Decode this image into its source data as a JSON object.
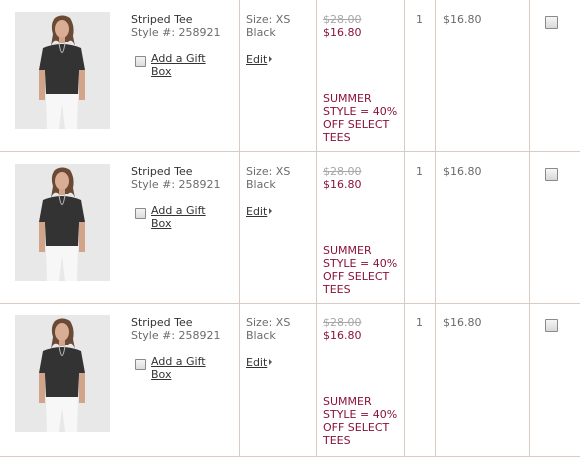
{
  "cart": {
    "items": [
      {
        "name": "Striped Tee",
        "style": "Style #: 258921",
        "gift_label": "Add a Gift Box",
        "size": "Size: XS",
        "color": "Black",
        "edit_label": "Edit",
        "original_price": "$28.00",
        "sale_price": "$16.80",
        "promo": "SUMMER STYLE = 40% OFF SELECT TEES",
        "quantity": "1",
        "total": "$16.80",
        "image_icon": "product-photo"
      },
      {
        "name": "Striped Tee",
        "style": "Style #: 258921",
        "gift_label": "Add a Gift Box",
        "size": "Size: XS",
        "color": "Black",
        "edit_label": "Edit",
        "original_price": "$28.00",
        "sale_price": "$16.80",
        "promo": "SUMMER STYLE = 40% OFF SELECT TEES",
        "quantity": "1",
        "total": "$16.80",
        "image_icon": "product-photo"
      },
      {
        "name": "Striped Tee",
        "style": "Style #: 258921",
        "gift_label": "Add a Gift Box",
        "size": "Size: XS",
        "color": "Black",
        "edit_label": "Edit",
        "original_price": "$28.00",
        "sale_price": "$16.80",
        "promo": "SUMMER STYLE = 40% OFF SELECT TEES",
        "quantity": "1",
        "total": "$16.80",
        "image_icon": "product-photo"
      }
    ]
  },
  "colors": {
    "sale_price": "#8a1338",
    "strikethrough": "#a8a8a8",
    "divider": "#d8ccc4",
    "text": "#6b6b6b"
  }
}
